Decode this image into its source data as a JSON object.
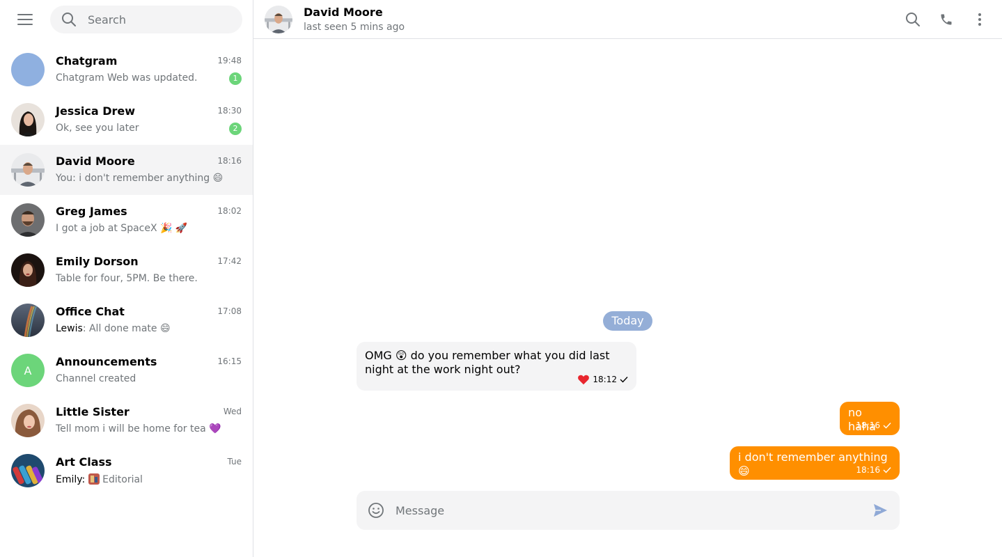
{
  "sidebar": {
    "search_placeholder": "Search",
    "chats": [
      {
        "name": "Chatgram",
        "time": "19:48",
        "preview": "Chatgram Web was updated.",
        "badge": "1"
      },
      {
        "name": "Jessica Drew",
        "time": "18:30",
        "preview": "Ok, see you later",
        "badge": "2"
      },
      {
        "name": "David Moore",
        "time": "18:16",
        "preview": "You: i don't remember anything 😄"
      },
      {
        "name": "Greg James",
        "time": "18:02",
        "preview": "I got a job at SpaceX 🎉 🚀"
      },
      {
        "name": "Emily Dorson",
        "time": "17:42",
        "preview": "Table for four, 5PM. Be there."
      },
      {
        "name": "Office Chat",
        "time": "17:08",
        "sender": "Lewis",
        "preview": ": All done mate 😄"
      },
      {
        "name": "Announcements",
        "time": "16:15",
        "preview": "Channel created",
        "avatar_letter": "A"
      },
      {
        "name": "Little Sister",
        "time": "Wed",
        "preview": "Tell mom i will be home for tea 💜"
      },
      {
        "name": "Art Class",
        "time": "Tue",
        "sender": "Emily",
        "preview": "Editorial"
      }
    ]
  },
  "header": {
    "name": "David Moore",
    "status": "last seen 5 mins ago"
  },
  "conversation": {
    "date_label": "Today",
    "messages": [
      {
        "text": "OMG 😲 do you remember what you did last night at the work night out?",
        "time": "18:12"
      },
      {
        "text": "no haha",
        "time": "18:16"
      },
      {
        "text": "i don't remember anything 😄",
        "time": "18:16"
      }
    ]
  },
  "composer": {
    "placeholder": "Message"
  },
  "colors": {
    "accent_out": "#ff8f00",
    "date_pill": "#94aed7",
    "badge": "#6cd57a",
    "bubble_in": "#f4f4f5"
  },
  "icons": {
    "menu": "hamburger-icon",
    "search": "search-icon",
    "phone": "phone-icon",
    "more": "more-vertical-icon",
    "emoji": "smiley-icon",
    "send": "send-icon",
    "heart": "heart-icon",
    "check": "check-icon"
  }
}
